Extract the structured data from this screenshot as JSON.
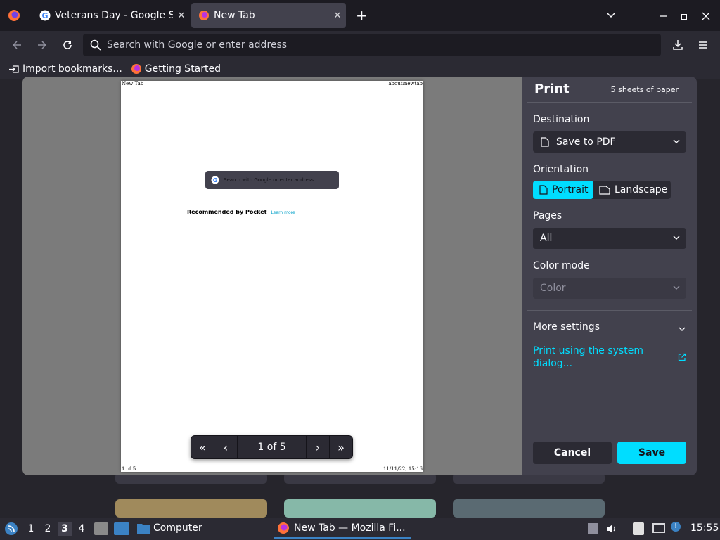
{
  "tabs": [
    {
      "title": "Veterans Day - Google Se",
      "icon": "google-icon"
    },
    {
      "title": "New Tab",
      "icon": "firefox-icon",
      "active": true
    }
  ],
  "navbar": {
    "url_placeholder": "Search with Google or enter address"
  },
  "bookmarks": [
    {
      "label": "Import bookmarks...",
      "icon": "import-icon"
    },
    {
      "label": "Getting Started",
      "icon": "firefox-icon"
    }
  ],
  "preview": {
    "header_left": "New Tab",
    "header_right": "about:newtab",
    "footer_left": "1 of 5",
    "footer_right": "11/11/22, 15:16",
    "search_text": "Search with Google or enter address",
    "pocket_title": "Recommended by Pocket",
    "pocket_link": "Learn more",
    "pager_text": "1 of 5"
  },
  "print": {
    "title": "Print",
    "sheets": "5 sheets of paper",
    "destination_label": "Destination",
    "destination_value": "Save to PDF",
    "orientation_label": "Orientation",
    "portrait": "Portrait",
    "landscape": "Landscape",
    "pages_label": "Pages",
    "pages_value": "All",
    "color_label": "Color mode",
    "color_value": "Color",
    "more_settings": "More settings",
    "system_dialog": "Print using the system dialog...",
    "cancel": "Cancel",
    "save": "Save"
  },
  "taskbar": {
    "workspaces": [
      "1",
      "2",
      "3",
      "4"
    ],
    "active_workspace": "3",
    "computer": "Computer",
    "window_title": "New Tab — Mozilla Fi...",
    "clock": "15:55"
  },
  "colors": {
    "accent": "#00ddff",
    "panel": "#42414d",
    "toolbar": "#2b2a33",
    "background": "#1c1b22"
  }
}
